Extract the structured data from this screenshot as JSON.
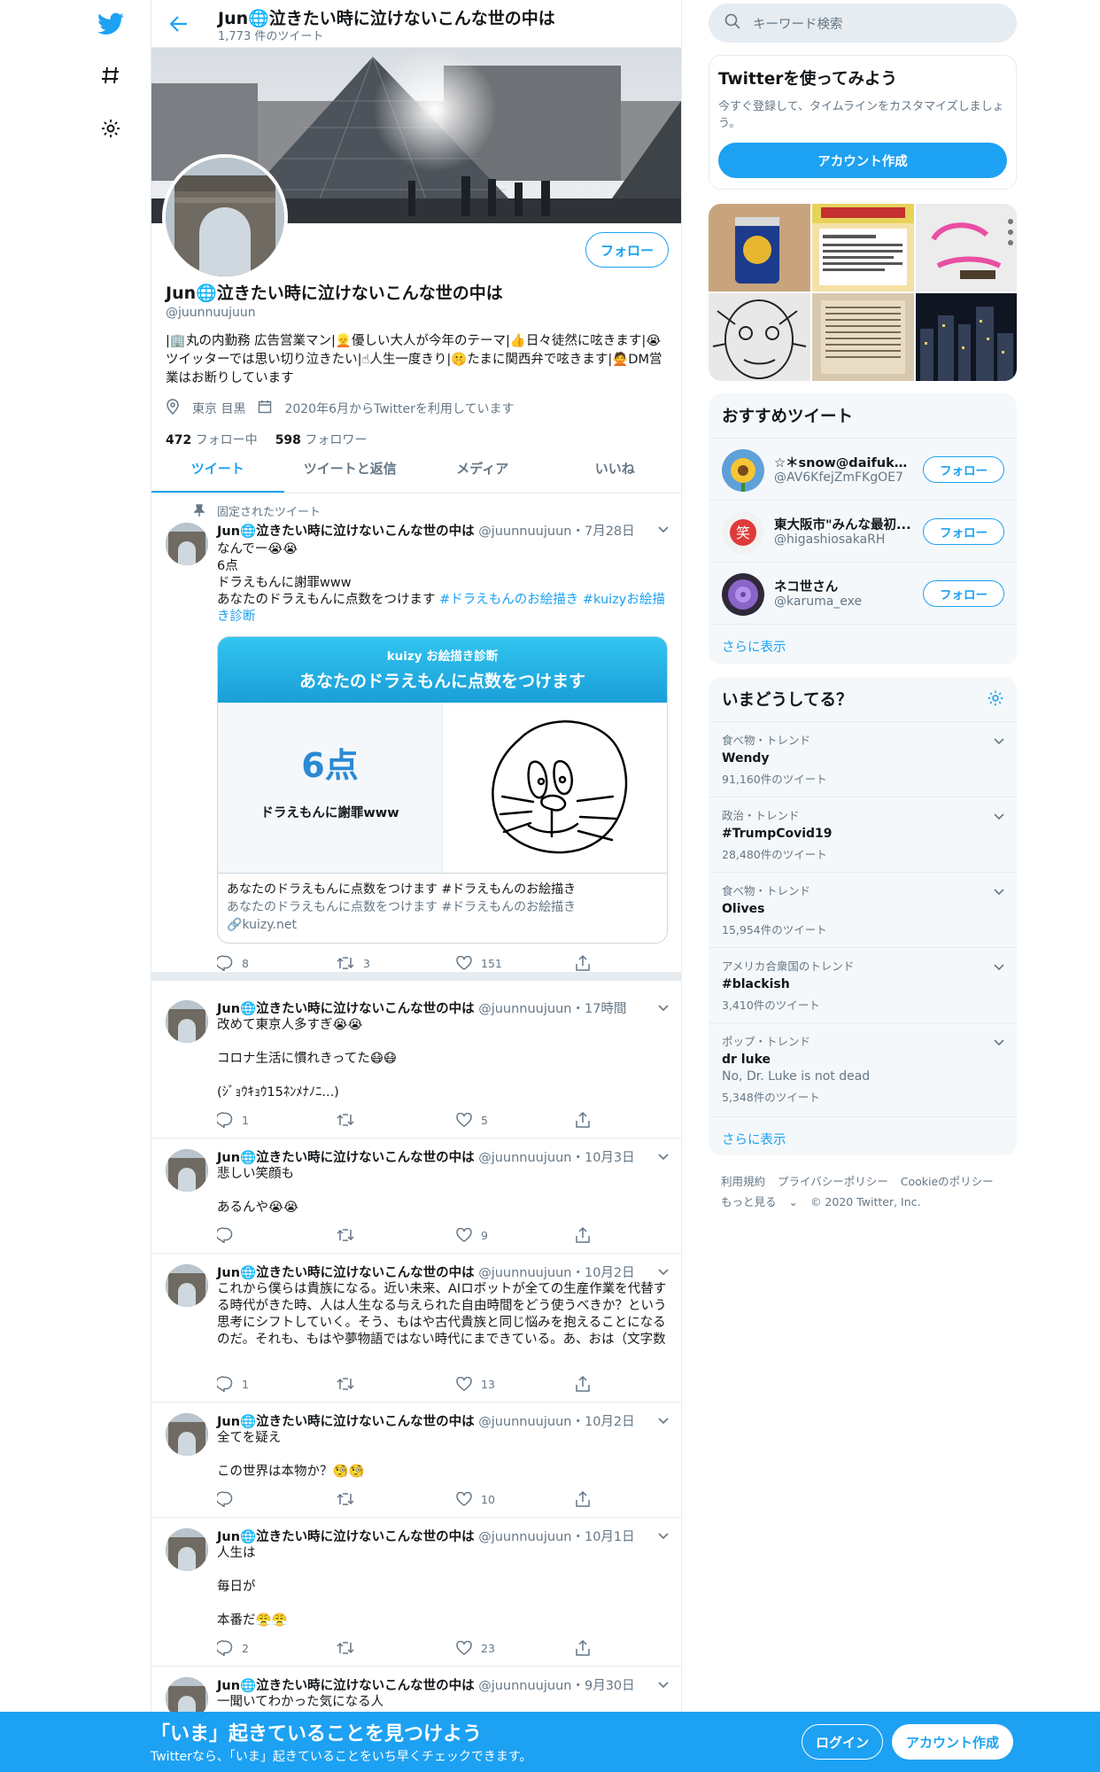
{
  "header": {
    "name": "Jun🌐泣きたい時に泣けないこんな世の中は",
    "tweet_count": "1,773 件のツイート"
  },
  "profile": {
    "name": "Jun🌐泣きたい時に泣けないこんな世の中は",
    "handle": "@juunnuujuun",
    "follow_label": "フォロー",
    "bio": "|🏢丸の内勤務 広告営業マン|👱優しい大人が今年のテーマ|👍日々徒然に呟きます|😭ツイッターでは思い切り泣きたい|☝人生一度きり|🤫たまに関西弁で呟きます|🙅DM営業はお断りしています",
    "location": "東京 目黒",
    "joined": "2020年6月からTwitterを利用しています",
    "following_count": "472",
    "following_label": "フォロー中",
    "followers_count": "598",
    "followers_label": "フォロワー"
  },
  "tabs": [
    "ツイート",
    "ツイートと返信",
    "メディア",
    "いいね"
  ],
  "pinned_label": "固定されたツイート",
  "tweets": [
    {
      "name": "Jun🌐泣きたい時に泣けないこんな世の中は",
      "handle": "@juunnuujuun",
      "time": "・7月28日",
      "text": "なんでー😭😭\n6点\nドラえもんに謝罪www\nあなたのドラえもんに点数をつけます ",
      "hashtags": "#ドラえもんのお絵描き #kuizyお絵描き診断",
      "replies": "8",
      "retweets": "3",
      "likes": "151"
    },
    {
      "name": "Jun🌐泣きたい時に泣けないこんな世の中は",
      "handle": "@juunnuujuun",
      "time": "・17時間",
      "text": "改めて東京人多すぎ😭😭\n\nコロナ生活に慣れきってた😷😷\n\n(ｼﾞｮｳｷｮｳ15ﾈﾝﾒﾅﾉﾆ...)",
      "replies": "1",
      "retweets": "",
      "likes": "5"
    },
    {
      "name": "Jun🌐泣きたい時に泣けないこんな世の中は",
      "handle": "@juunnuujuun",
      "time": "・10月3日",
      "text": "悲しい笑顔も\n\nあるんや😭😭",
      "replies": "",
      "retweets": "",
      "likes": "9"
    },
    {
      "name": "Jun🌐泣きたい時に泣けないこんな世の中は",
      "handle": "@juunnuujuun",
      "time": "・10月2日",
      "text": "これから僕らは貴族になる。近い未来、AIロボットが全ての生産作業を代替する時代がきた時、人は人生なる与えられた自由時間をどう使うべきか？という思考にシフトしていく。そう、もはや古代貴族と同じ悩みを抱えることになるのだ。それも、もはや夢物語ではない時代にまできている。あ、おは（文字数",
      "replies": "1",
      "retweets": "",
      "likes": "13"
    },
    {
      "name": "Jun🌐泣きたい時に泣けないこんな世の中は",
      "handle": "@juunnuujuun",
      "time": "・10月2日",
      "text": "全てを疑え\n\nこの世界は本物か？🧐🧐",
      "replies": "",
      "retweets": "",
      "likes": "10"
    },
    {
      "name": "Jun🌐泣きたい時に泣けないこんな世の中は",
      "handle": "@juunnuujuun",
      "time": "・10月1日",
      "text": "人生は\n\n毎日が\n\n本番だ😤😤",
      "replies": "2",
      "retweets": "",
      "likes": "23"
    },
    {
      "name": "Jun🌐泣きたい時に泣けないこんな世の中は",
      "handle": "@juunnuujuun",
      "time": "・9月30日",
      "text": "一聞いてわかった気になる人",
      "replies": "",
      "retweets": "",
      "likes": ""
    }
  ],
  "card": {
    "brand": "kuizy お絵描き診断",
    "title": "あなたのドラえもんに点数をつけます",
    "points": "6点",
    "apology": "ドラえもんに謝罪www",
    "foot_title": "あなたのドラえもんに点数をつけます #ドラえもんのお絵描き",
    "foot_desc": "あなたのドラえもんに点数をつけます #ドラえもんのお絵描き",
    "domain": "kuizy.net"
  },
  "sidebar": {
    "search_placeholder": "キーワード検索",
    "signup_title": "Twitterを使ってみよう",
    "signup_desc": "今すぐ登録して、タイムラインをカスタマイズしましょう。",
    "signup_button": "アカウント作成",
    "rec_title": "おすすめツイート",
    "recs": [
      {
        "name": "☆＊snow@daifuku＊☆",
        "handle": "@AV6KfejZmFKgOE7",
        "button": "フォロー"
      },
      {
        "name": "東大阪市\"みんな最初...",
        "handle": "@higashiosakaRH",
        "button": "フォロー"
      },
      {
        "name": "ネコ世さん",
        "handle": "@karuma_exe",
        "button": "フォロー"
      }
    ],
    "more": "さらに表示",
    "trend_title": "いまどうしてる？",
    "trends": [
      {
        "category": "食べ物・トレンド",
        "name": "Wendy",
        "desc": "",
        "count": "91,160件のツイート"
      },
      {
        "category": "政治・トレンド",
        "name": "#TrumpCovid19",
        "desc": "",
        "count": "28,480件のツイート"
      },
      {
        "category": "食べ物・トレンド",
        "name": "Olives",
        "desc": "",
        "count": "15,954件のツイート"
      },
      {
        "category": "アメリカ合衆国のトレンド",
        "name": "#blackish",
        "desc": "",
        "count": "3,410件のツイート"
      },
      {
        "category": "ポップ・トレンド",
        "name": "dr luke",
        "desc": "No, Dr. Luke is not dead",
        "count": "5,348件のツイート"
      }
    ],
    "trend_more": "さらに表示",
    "footer_links": [
      "利用規約",
      "プライバシーポリシー",
      "Cookieのポリシー"
    ],
    "footer_more": "もっと見る",
    "copyright": "© 2020 Twitter, Inc."
  },
  "bottom_banner": {
    "title": "「いま」起きていることを見つけよう",
    "subtitle": "Twitterなら、「いま」起きていることをいち早くチェックできます。",
    "login": "ログイン",
    "signup": "アカウント作成"
  },
  "colors": {
    "accent": "#1da1f2",
    "text": "#14171a",
    "secondary": "#657786",
    "border": "#e6ecf0"
  }
}
